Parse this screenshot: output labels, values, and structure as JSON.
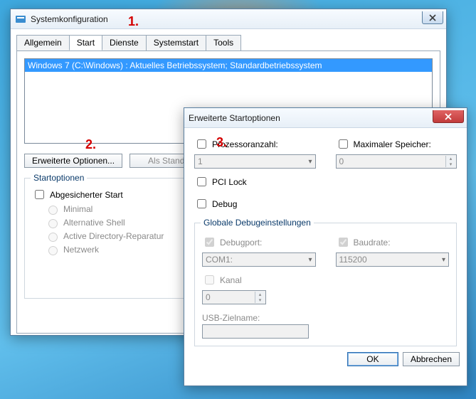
{
  "annotations": {
    "a1": "1.",
    "a2": "2.",
    "a3": "3."
  },
  "main": {
    "title": "Systemkonfiguration",
    "tabs": [
      "Allgemein",
      "Start",
      "Dienste",
      "Systemstart",
      "Tools"
    ],
    "active_tab_index": 1,
    "boot_list": {
      "items": [
        "Windows 7 (C:\\Windows) : Aktuelles Betriebssystem; Standardbetriebssystem"
      ],
      "selected_index": 0
    },
    "buttons": {
      "advanced": "Erweiterte Optionen...",
      "set_default": "Als Standa"
    },
    "boot_options": {
      "legend": "Startoptionen",
      "safe_boot": "Abgesicherter Start",
      "minimal": "Minimal",
      "altshell": "Alternative Shell",
      "ad_repair": "Active Directory-Reparatur",
      "network": "Netzwerk"
    }
  },
  "adv": {
    "title": "Erweiterte Startoptionen",
    "cpu_label": "Prozessoranzahl:",
    "cpu_value": "1",
    "maxmem_label": "Maximaler Speicher:",
    "maxmem_value": "0",
    "pcilock": "PCI Lock",
    "debug": "Debug",
    "global_legend": "Globale Debugeinstellungen",
    "debugport_label": "Debugport:",
    "debugport_value": "COM1:",
    "baud_label": "Baudrate:",
    "baud_value": "115200",
    "channel_label": "Kanal",
    "channel_value": "0",
    "usb_label": "USB-Zielname:",
    "usb_value": "",
    "ok": "OK",
    "cancel": "Abbrechen"
  }
}
